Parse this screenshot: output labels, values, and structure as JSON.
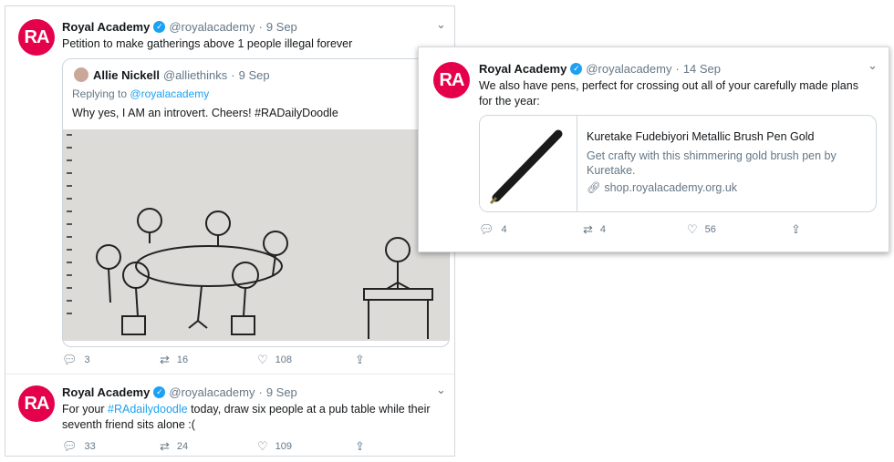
{
  "left": {
    "tweet1": {
      "avatar_text": "RA",
      "name": "Royal Academy",
      "handle": "@royalacademy",
      "date": "9 Sep",
      "text": "Petition to make gatherings above 1 people illegal forever",
      "quote": {
        "name": "Allie Nickell",
        "handle": "@alliethinks",
        "date": "9 Sep",
        "replying": "Replying to",
        "replying_handle": "@royalacademy",
        "text": "Why yes, I AM an introvert. Cheers! #RADailyDoodle"
      },
      "actions": {
        "replies": "3",
        "retweets": "16",
        "likes": "108"
      }
    },
    "tweet2": {
      "avatar_text": "RA",
      "name": "Royal Academy",
      "handle": "@royalacademy",
      "date": "9 Sep",
      "text_pre": "For your",
      "hashtag": "#RAdailydoodle",
      "text_post": "today, draw six people at a pub table while their seventh friend sits alone :(",
      "actions": {
        "replies": "33",
        "retweets": "24",
        "likes": "109"
      }
    }
  },
  "right": {
    "tweet": {
      "avatar_text": "RA",
      "name": "Royal Academy",
      "handle": "@royalacademy",
      "date": "14 Sep",
      "text": "We also have pens, perfect for crossing out all of your carefully made plans for the year:",
      "link": {
        "title": "Kuretake Fudebiyori Metallic Brush Pen Gold",
        "desc": "Get crafty with this shimmering gold brush pen by Kuretake.",
        "url": "shop.royalacademy.org.uk"
      },
      "actions": {
        "replies": "4",
        "retweets": "4",
        "likes": "56"
      }
    }
  },
  "colors": {
    "brand": "#e5004c",
    "link": "#1da1f2",
    "muted": "#657786"
  },
  "icons": [
    "verified-icon",
    "chevron-down-icon",
    "reply-icon",
    "retweet-icon",
    "like-icon",
    "share-icon",
    "link-icon"
  ]
}
